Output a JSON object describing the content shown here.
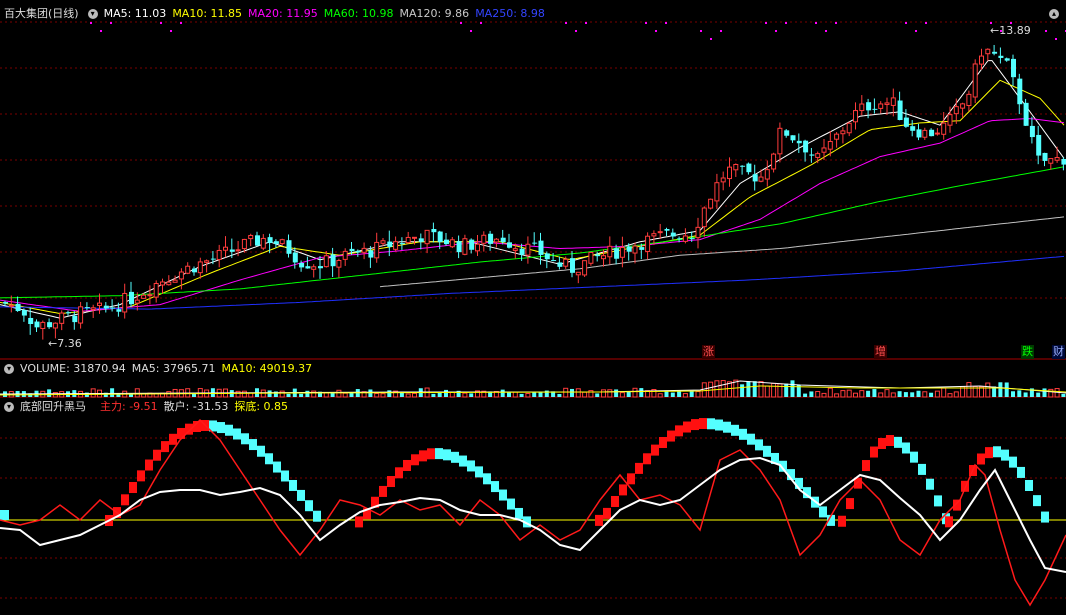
{
  "price_panel": {
    "title": "百大集团(日线)",
    "ma5": "MA5: 11.03",
    "ma10": "MA10: 11.85",
    "ma20": "MA20: 11.95",
    "ma60": "MA60: 10.98",
    "ma120": "MA120: 9.86",
    "ma250": "MA250: 8.98",
    "high_label": "13.89",
    "low_label": "7.36",
    "events": [
      "涨",
      "增",
      "跌",
      "财"
    ]
  },
  "volume_panel": {
    "volume": "VOLUME: 31870.94",
    "ma5": "MA5: 37965.71",
    "ma10": "MA10: 49019.37"
  },
  "indicator_panel": {
    "title": "底部回升黑马",
    "main_force": "主力: -9.51",
    "retail": "散户: -31.53",
    "bottom": "探底: 0.85"
  },
  "colors": {
    "up": "#ff3c3c",
    "down": "#54ffff",
    "ma5": "#ffffff",
    "ma10": "#ffff00",
    "ma20": "#ff00ff",
    "ma60": "#00ff00",
    "ma120": "#c0c0c0",
    "ma250": "#2030ff",
    "grid": "#7a0000"
  },
  "chart_data": {
    "type": "candlestick",
    "title": "百大集团(日线)",
    "ylim": [
      7.0,
      14.2
    ],
    "price_path": [
      [
        0,
        7.95
      ],
      [
        20,
        7.8
      ],
      [
        35,
        7.4
      ],
      [
        55,
        7.55
      ],
      [
        80,
        7.7
      ],
      [
        105,
        7.8
      ],
      [
        130,
        8.05
      ],
      [
        160,
        8.45
      ],
      [
        190,
        8.75
      ],
      [
        215,
        8.95
      ],
      [
        240,
        9.2
      ],
      [
        265,
        9.4
      ],
      [
        285,
        9.15
      ],
      [
        300,
        8.85
      ],
      [
        320,
        8.8
      ],
      [
        345,
        9.0
      ],
      [
        370,
        9.1
      ],
      [
        395,
        9.3
      ],
      [
        420,
        9.45
      ],
      [
        440,
        9.35
      ],
      [
        460,
        9.2
      ],
      [
        480,
        9.3
      ],
      [
        500,
        9.4
      ],
      [
        515,
        9.2
      ],
      [
        535,
        9.1
      ],
      [
        555,
        8.8
      ],
      [
        570,
        8.7
      ],
      [
        590,
        8.9
      ],
      [
        615,
        9.1
      ],
      [
        640,
        9.3
      ],
      [
        665,
        9.45
      ],
      [
        690,
        9.5
      ],
      [
        710,
        10.4
      ],
      [
        725,
        10.9
      ],
      [
        745,
        10.8
      ],
      [
        760,
        10.75
      ],
      [
        780,
        11.8
      ],
      [
        800,
        11.5
      ],
      [
        815,
        11.1
      ],
      [
        830,
        11.5
      ],
      [
        850,
        12.1
      ],
      [
        870,
        12.4
      ],
      [
        890,
        12.4
      ],
      [
        905,
        11.9
      ],
      [
        925,
        11.7
      ],
      [
        945,
        11.9
      ],
      [
        965,
        12.5
      ],
      [
        980,
        13.6
      ],
      [
        990,
        13.5
      ],
      [
        1005,
        13.2
      ],
      [
        1020,
        12.3
      ],
      [
        1035,
        11.1
      ],
      [
        1050,
        11.1
      ],
      [
        1066,
        11.2
      ]
    ],
    "ma_paths": {
      "ma5": [
        [
          0,
          7.9
        ],
        [
          60,
          7.6
        ],
        [
          120,
          7.9
        ],
        [
          200,
          8.75
        ],
        [
          270,
          9.3
        ],
        [
          320,
          8.9
        ],
        [
          400,
          9.3
        ],
        [
          470,
          9.3
        ],
        [
          560,
          8.8
        ],
        [
          640,
          9.3
        ],
        [
          700,
          9.55
        ],
        [
          740,
          10.6
        ],
        [
          800,
          11.4
        ],
        [
          860,
          12.1
        ],
        [
          900,
          12.2
        ],
        [
          940,
          11.9
        ],
        [
          990,
          13.4
        ],
        [
          1030,
          12.2
        ],
        [
          1066,
          11.1
        ]
      ],
      "ma10": [
        [
          0,
          7.95
        ],
        [
          60,
          7.7
        ],
        [
          130,
          7.85
        ],
        [
          210,
          8.6
        ],
        [
          280,
          9.2
        ],
        [
          340,
          9.0
        ],
        [
          420,
          9.3
        ],
        [
          500,
          9.3
        ],
        [
          570,
          8.9
        ],
        [
          640,
          9.2
        ],
        [
          700,
          9.45
        ],
        [
          750,
          10.3
        ],
        [
          810,
          11.0
        ],
        [
          870,
          11.8
        ],
        [
          920,
          11.95
        ],
        [
          960,
          12.0
        ],
        [
          1000,
          12.9
        ],
        [
          1040,
          12.5
        ],
        [
          1066,
          11.85
        ]
      ],
      "ma20": [
        [
          0,
          8.0
        ],
        [
          80,
          7.75
        ],
        [
          160,
          7.9
        ],
        [
          240,
          8.45
        ],
        [
          320,
          8.95
        ],
        [
          400,
          9.1
        ],
        [
          480,
          9.3
        ],
        [
          560,
          9.15
        ],
        [
          630,
          9.2
        ],
        [
          700,
          9.35
        ],
        [
          760,
          9.8
        ],
        [
          820,
          10.6
        ],
        [
          880,
          11.2
        ],
        [
          940,
          11.5
        ],
        [
          990,
          12.0
        ],
        [
          1030,
          12.05
        ],
        [
          1066,
          11.95
        ]
      ],
      "ma60": [
        [
          0,
          8.05
        ],
        [
          120,
          8.1
        ],
        [
          240,
          8.25
        ],
        [
          360,
          8.55
        ],
        [
          480,
          8.85
        ],
        [
          580,
          9.05
        ],
        [
          680,
          9.35
        ],
        [
          780,
          9.7
        ],
        [
          880,
          10.2
        ],
        [
          960,
          10.55
        ],
        [
          1066,
          10.98
        ]
      ],
      "ma120": [
        [
          380,
          8.3
        ],
        [
          480,
          8.5
        ],
        [
          580,
          8.7
        ],
        [
          680,
          9.0
        ],
        [
          780,
          9.15
        ],
        [
          880,
          9.4
        ],
        [
          980,
          9.65
        ],
        [
          1066,
          9.86
        ]
      ],
      "ma250": [
        [
          0,
          7.85
        ],
        [
          150,
          7.8
        ],
        [
          300,
          7.95
        ],
        [
          450,
          8.15
        ],
        [
          600,
          8.3
        ],
        [
          750,
          8.45
        ],
        [
          900,
          8.65
        ],
        [
          1066,
          8.98
        ]
      ]
    }
  }
}
